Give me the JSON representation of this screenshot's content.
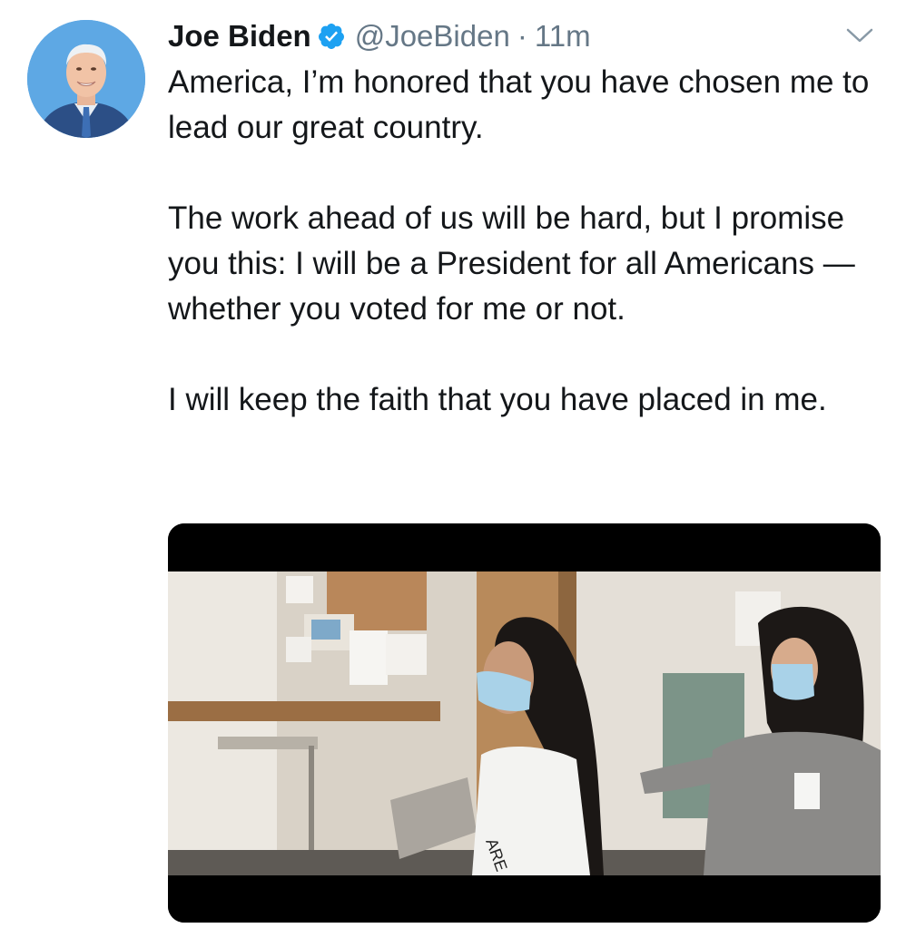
{
  "tweet": {
    "author_name": "Joe Biden",
    "handle": "@JoeBiden",
    "separator": "·",
    "time": "11m",
    "paragraphs": [
      "America, I’m honored that you have chosen me to lead our great country.",
      "The work ahead of us will be hard, but I promise you this: I will be a President for all Americans — whether you voted for me or not.",
      "I will keep the faith that you have placed in me."
    ],
    "media_shirt_text": "ARE"
  },
  "icons": {
    "verified": "verified-badge-icon",
    "caret": "chevron-down-icon"
  },
  "colors": {
    "verified_blue": "#1da1f2",
    "secondary_text": "#657786",
    "primary_text": "#14171a"
  }
}
